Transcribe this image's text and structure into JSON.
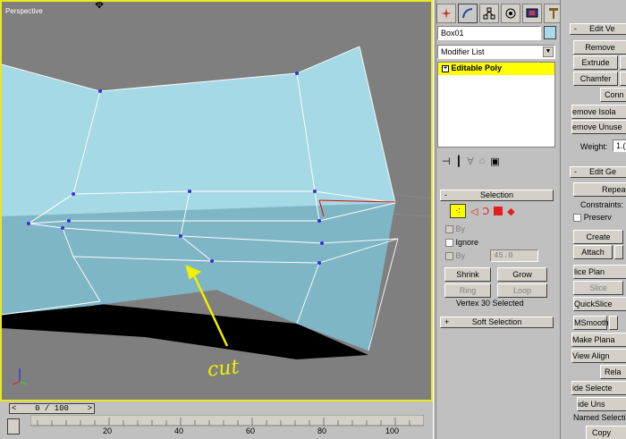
{
  "viewport": {
    "label": "Perspective",
    "annotation": "cut"
  },
  "timeline": {
    "slider": "0 / 100",
    "ticks": [
      "20",
      "40",
      "60",
      "80",
      "100"
    ]
  },
  "command_panel": {
    "tabs": [
      "create-icon",
      "modify-icon",
      "hierarchy-icon",
      "motion-icon",
      "display-icon",
      "utilities-icon"
    ],
    "object_name": "Box01",
    "object_color": "#a8d8ea",
    "modifier_list": "Modifier List",
    "stack_item": "Editable Poly",
    "selection": {
      "title": "Selection",
      "by_vertex": "By",
      "ignore": "Ignore",
      "by_angle": "By",
      "angle_value": "45.0",
      "shrink": "Shrink",
      "grow": "Grow",
      "ring": "Ring",
      "loop": "Loop",
      "status": "Vertex 30 Selected"
    },
    "soft_selection": {
      "title": "Soft Selection"
    }
  },
  "edit_vertices": {
    "title": "Edit Ve",
    "remove": "Remove",
    "extrude": "Extrude",
    "chamfer": "Chamfer",
    "connect": "Conn",
    "remove_isolated": "emove Isola",
    "remove_unused": "emove Unuse",
    "weight_label": "Weight:",
    "weight_value": "1.("
  },
  "edit_geometry": {
    "title": "Edit Ge",
    "repeat": "Repeat",
    "constraints": "Constraints:",
    "preserve": "Preserv",
    "create": "Create",
    "attach": "Attach",
    "slice_plane": "lice Plan",
    "slice": "Slice",
    "quickslice": "QuickSlice",
    "msmooth": "MSmooth",
    "make_planar": "Make Plana",
    "view_align": "View Align",
    "relax": "Rela",
    "hide_selected": "ide Selecte",
    "hide_unselected": "ide Uns",
    "named_selections": "Named Selecti",
    "copy": "Copy"
  }
}
